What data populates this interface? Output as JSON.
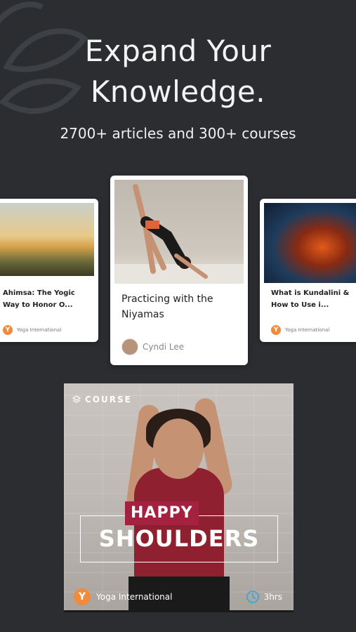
{
  "header": {
    "headline_line1": "Expand Your",
    "headline_line2": "Knowledge.",
    "subline": "2700+ articles and 300+ courses"
  },
  "cards": {
    "left": {
      "title": "Ahimsa: The Yogic Way to Honor O...",
      "brand": "Yoga International",
      "logo_letter": "Y"
    },
    "center": {
      "title": "Practicing with the Niyamas",
      "author": "Cyndi Lee"
    },
    "right": {
      "title": "What is Kundalini & How to Use i...",
      "brand": "Yoga International",
      "logo_letter": "Y"
    }
  },
  "course": {
    "tag": "COURSE",
    "title_line1": "HAPPY",
    "title_line2": "SHOULDERS",
    "brand": "Yoga International",
    "logo_letter": "Y",
    "duration": "3hrs"
  },
  "colors": {
    "background": "#2b2d30",
    "brand_orange": "#f08a3c",
    "happy_badge": "#a4223f"
  },
  "icons": [
    "leaf-decoration-icon",
    "yoga-international-logo-icon",
    "layers-icon",
    "clock-icon"
  ]
}
